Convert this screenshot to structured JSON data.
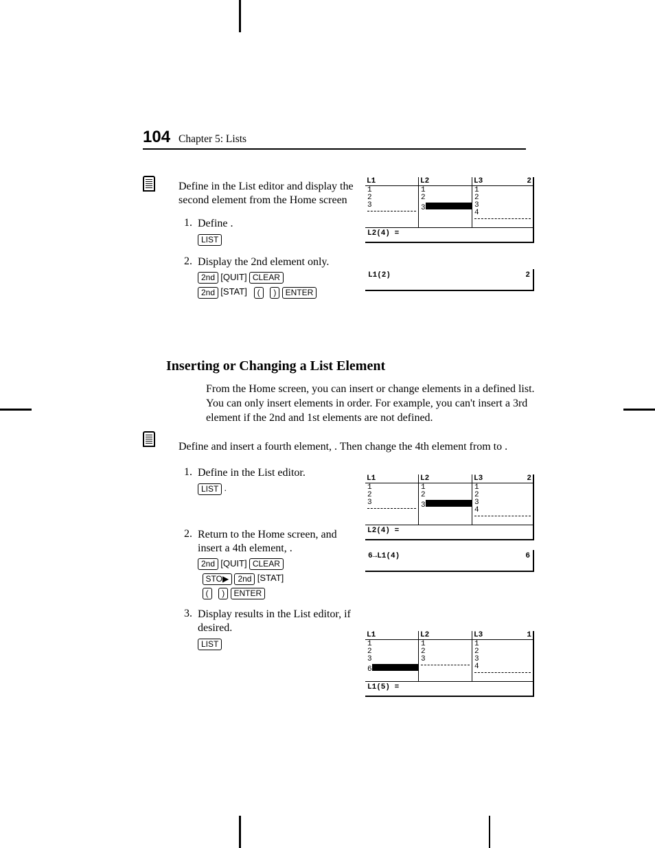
{
  "header": {
    "page_number": "104",
    "chapter": "Chapter 5: Lists"
  },
  "example1": {
    "intro": "Define               in the List editor and display the second element from the Home screen",
    "step1": {
      "num": "1.",
      "text": "Define    .",
      "key": "LIST"
    },
    "step2": {
      "num": "2.",
      "text": "Display the 2nd element only.",
      "keys": {
        "k2nd": "2nd",
        "quit": "QUIT",
        "clear": "CLEAR",
        "stat": "STAT",
        "lp": "(",
        "rp": ")",
        "enter": "ENTER"
      }
    },
    "screen1": {
      "head": {
        "l1": "L1",
        "l2": "L2",
        "l3": "L3",
        "n": "2"
      },
      "col1": "1\n2\n3",
      "col2": "1\n2\n3",
      "col3": "1\n2\n3\n4",
      "status": "L2(4)  ="
    },
    "screen2": {
      "left": "L1(2)",
      "right": "2"
    }
  },
  "section": {
    "heading": "Inserting or Changing a List Element",
    "body": "From the Home screen, you can insert or change elements in a defined list. You can only insert elements in order. For example, you can't insert a 3rd element if the 2nd and 1st elements are not defined."
  },
  "example2": {
    "intro": "Define               and insert a fourth element,   . Then change the 4th element from     to    .",
    "step1": {
      "num": "1.",
      "text": "Define     in the List editor.",
      "key": "LIST",
      "after": "."
    },
    "step2": {
      "num": "2.",
      "text": "Return to the Home screen, and insert a 4th element,   .",
      "keys": {
        "k2nd": "2nd",
        "quit": "QUIT",
        "clear": "CLEAR",
        "sto": "STO▶",
        "stat": "STAT",
        "lp": "(",
        "rp": ")",
        "enter": "ENTER"
      }
    },
    "step3": {
      "num": "3.",
      "text": "Display results in the List editor, if desired.",
      "key": "LIST"
    },
    "screen1": {
      "head": {
        "l1": "L1",
        "l2": "L2",
        "l3": "L3",
        "n": "2"
      },
      "col1": "1\n2\n3",
      "col2": "1\n2\n3",
      "col3": "1\n2\n3\n4",
      "status": "L2(4)  ="
    },
    "screen2": {
      "left": "6→L1(4)",
      "right": "6"
    },
    "screen3": {
      "head": {
        "l1": "L1",
        "l2": "L2",
        "l3": "L3",
        "n": "1"
      },
      "col1": "1\n2\n3\n6",
      "col2": "1\n2\n3",
      "col3": "1\n2\n3\n4",
      "status": "L1(5)  ="
    }
  }
}
